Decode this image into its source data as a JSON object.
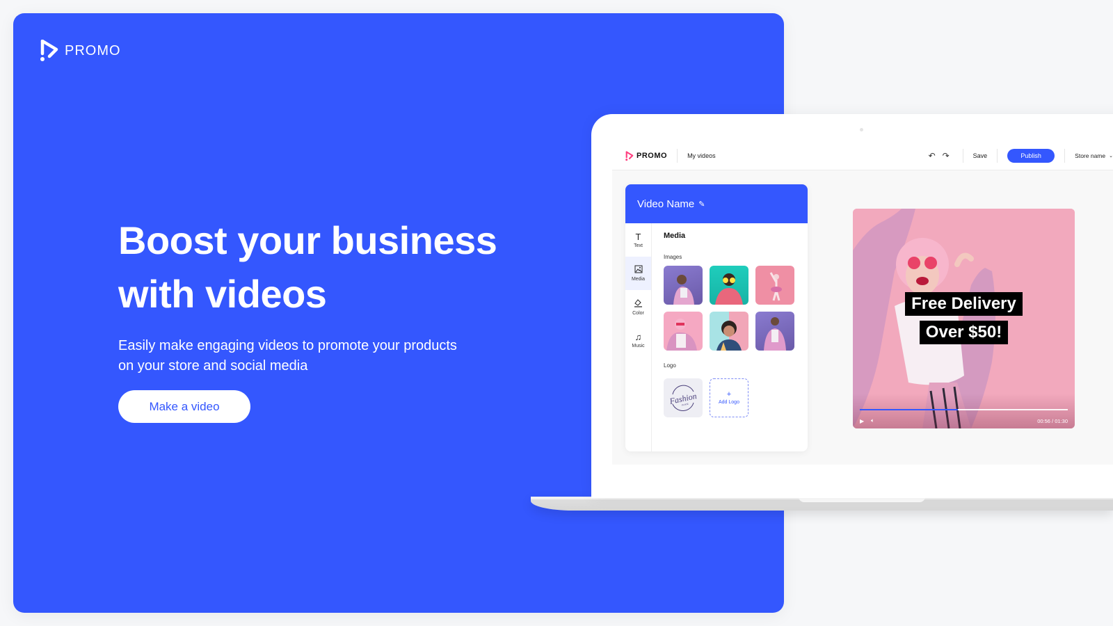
{
  "brand": {
    "name": "PROMO",
    "icon": "play-logo-icon"
  },
  "hero": {
    "headline_line1": "Boost your business",
    "headline_line2": "with videos",
    "subline_line1": "Easily make engaging videos to promote your products",
    "subline_line2": "on your store and social media",
    "cta_label": "Make a video"
  },
  "colors": {
    "primary": "#3457fe",
    "background": "#f6f7f9",
    "logo_accent": "#ff3f7f"
  },
  "app": {
    "logo_name": "PROMO",
    "nav_link": "My videos",
    "undo_icon": "undo-icon",
    "redo_icon": "redo-icon",
    "save_label": "Save",
    "publish_label": "Publish",
    "store_label": "Store name",
    "editor": {
      "title": "Video Name",
      "title_edit_icon": "pencil-icon",
      "tools": [
        {
          "label": "Text",
          "icon": "text-icon",
          "glyph": "T"
        },
        {
          "label": "Media",
          "icon": "image-icon",
          "glyph": "🖼"
        },
        {
          "label": "Color",
          "icon": "paint-bucket-icon",
          "glyph": "◇"
        },
        {
          "label": "Music",
          "icon": "music-note-icon",
          "glyph": "♫"
        }
      ],
      "active_tool": "Media",
      "panel_title": "Media",
      "images_label": "Images",
      "logo_label": "Logo",
      "logo_text": "Fashion",
      "logo_subtext": "PLACE",
      "add_logo_label": "Add Logo",
      "images": [
        {
          "name": "woman-purple-background"
        },
        {
          "name": "woman-teal-background"
        },
        {
          "name": "dancer-pink-background"
        },
        {
          "name": "woman-pink-wig"
        },
        {
          "name": "woman-ice-cream"
        },
        {
          "name": "woman-purple-jacket"
        }
      ]
    },
    "video": {
      "caption_line1": "Free Delivery",
      "caption_line2": "Over $50!",
      "current_time": "00:56",
      "total_time": "01:30",
      "timecode": "00:56 / 01:30",
      "progress": 0.47
    }
  }
}
